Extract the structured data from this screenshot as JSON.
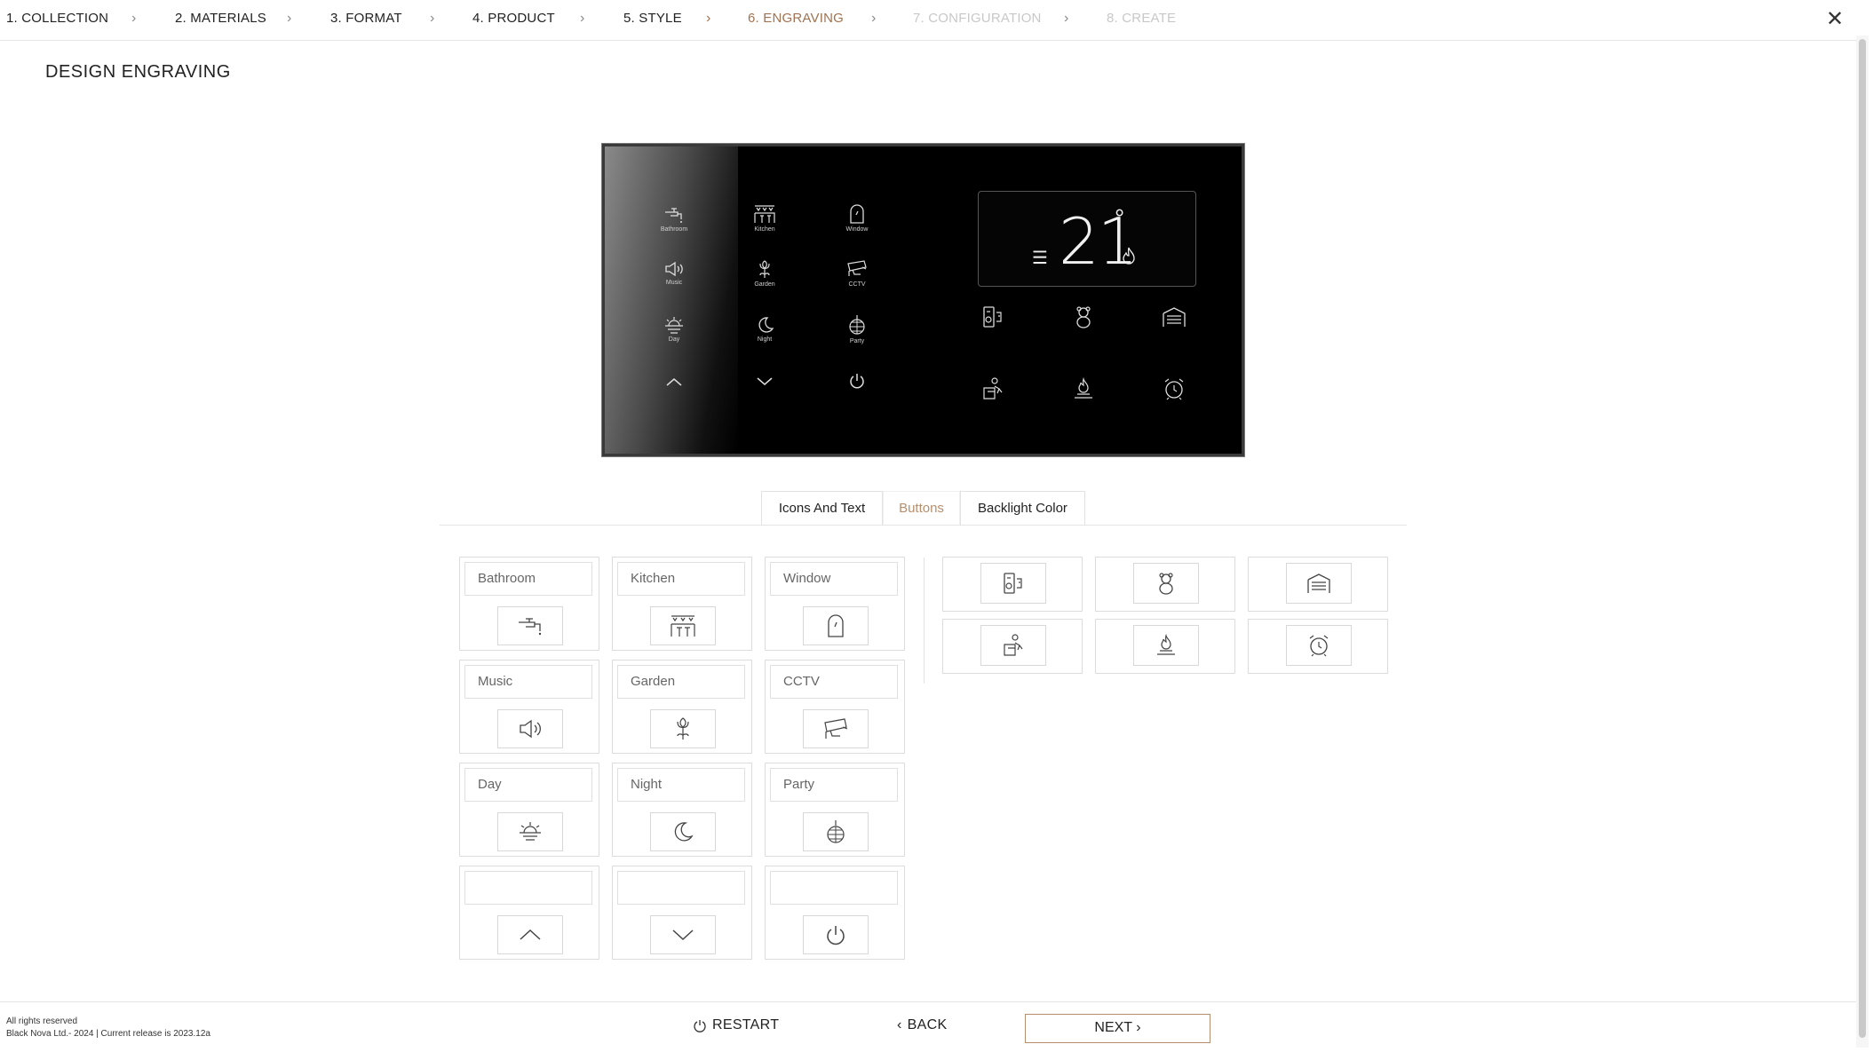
{
  "stepper": {
    "steps": [
      {
        "label": "1. COLLECTION",
        "state": "done"
      },
      {
        "label": "2. MATERIALS",
        "state": "done"
      },
      {
        "label": "3. FORMAT",
        "state": "done"
      },
      {
        "label": "4. PRODUCT",
        "state": "done"
      },
      {
        "label": "5. STYLE",
        "state": "done"
      },
      {
        "label": "6. ENGRAVING",
        "state": "active"
      },
      {
        "label": "7. CONFIGURATION",
        "state": "disabled"
      },
      {
        "label": "8. CREATE",
        "state": "disabled"
      }
    ],
    "close_icon": "close-icon"
  },
  "page_title": "DESIGN ENGRAVING",
  "preview": {
    "buttons": [
      {
        "label": "Bathroom",
        "icon": "faucet-icon"
      },
      {
        "label": "Kitchen",
        "icon": "kitchen-lights-icon"
      },
      {
        "label": "Window",
        "icon": "window-icon"
      },
      {
        "label": "Music",
        "icon": "speaker-icon"
      },
      {
        "label": "Garden",
        "icon": "flower-icon"
      },
      {
        "label": "CCTV",
        "icon": "cctv-camera-icon"
      },
      {
        "label": "Day",
        "icon": "sunrise-icon"
      },
      {
        "label": "Night",
        "icon": "moon-icon"
      },
      {
        "label": "Party",
        "icon": "disco-ball-icon"
      }
    ],
    "bottom_row": [
      "chevron-up-icon",
      "chevron-down-icon",
      "power-icon"
    ],
    "thermostat": {
      "temperature": "21",
      "degree": "°"
    },
    "right_icons": [
      "speaker-phone-icon",
      "teddy-bear-icon",
      "garage-icon",
      "person-sofa-icon",
      "fireplace-icon",
      "alarm-clock-icon"
    ]
  },
  "tabs": [
    {
      "label": "Icons And Text",
      "selected": false
    },
    {
      "label": "Buttons",
      "selected": true
    },
    {
      "label": "Backlight Color",
      "selected": false
    }
  ],
  "editor": {
    "cards": [
      {
        "text": "Bathroom",
        "icon": "faucet-icon"
      },
      {
        "text": "Kitchen",
        "icon": "kitchen-lights-icon"
      },
      {
        "text": "Window",
        "icon": "window-icon"
      },
      {
        "text": "Music",
        "icon": "speaker-icon"
      },
      {
        "text": "Garden",
        "icon": "flower-icon"
      },
      {
        "text": "CCTV",
        "icon": "cctv-camera-icon"
      },
      {
        "text": "Day",
        "icon": "sunrise-icon"
      },
      {
        "text": "Night",
        "icon": "moon-icon"
      },
      {
        "text": "Party",
        "icon": "disco-ball-icon"
      },
      {
        "text": "",
        "icon": "chevron-up-icon"
      },
      {
        "text": "",
        "icon": "chevron-down-icon"
      },
      {
        "text": "",
        "icon": "power-icon"
      }
    ],
    "right_cards": [
      "speaker-phone-icon",
      "teddy-bear-icon",
      "garage-icon",
      "person-sofa-icon",
      "fireplace-icon",
      "alarm-clock-icon"
    ]
  },
  "footer": {
    "rights": "All rights reserved",
    "release": "Black Nova Ltd.- 2024 | Current release is 2023.12a",
    "restart": "RESTART",
    "back": "BACK",
    "next": "NEXT"
  },
  "colors": {
    "accent": "#b88f6e",
    "active_step": "#a07352",
    "disabled_step": "#c8c8c8"
  }
}
